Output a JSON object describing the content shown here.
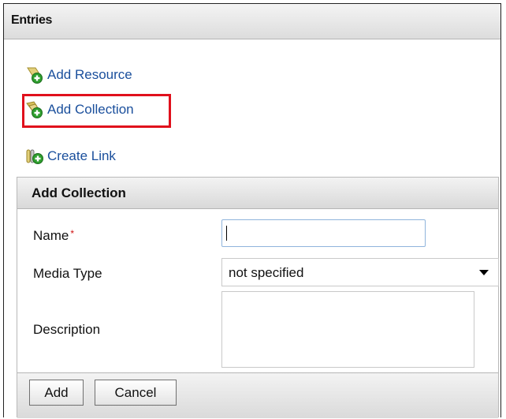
{
  "entries": {
    "title": "Entries"
  },
  "actions": [
    {
      "label": "Add Resource",
      "icon": "add-resource-icon"
    },
    {
      "label": "Add Collection",
      "icon": "add-collection-icon"
    },
    {
      "label": "Create Link",
      "icon": "create-link-icon"
    }
  ],
  "form": {
    "title": "Add Collection",
    "name_label": "Name",
    "required_mark": "*",
    "media_type_label": "Media Type",
    "media_type_value": "not specified",
    "description_label": "Description",
    "add_button": "Add",
    "cancel_button": "Cancel"
  },
  "colors": {
    "link": "#1a4f9c",
    "highlight": "#e0101c",
    "required": "#d01010",
    "icon_green": "#2e9e2e"
  }
}
